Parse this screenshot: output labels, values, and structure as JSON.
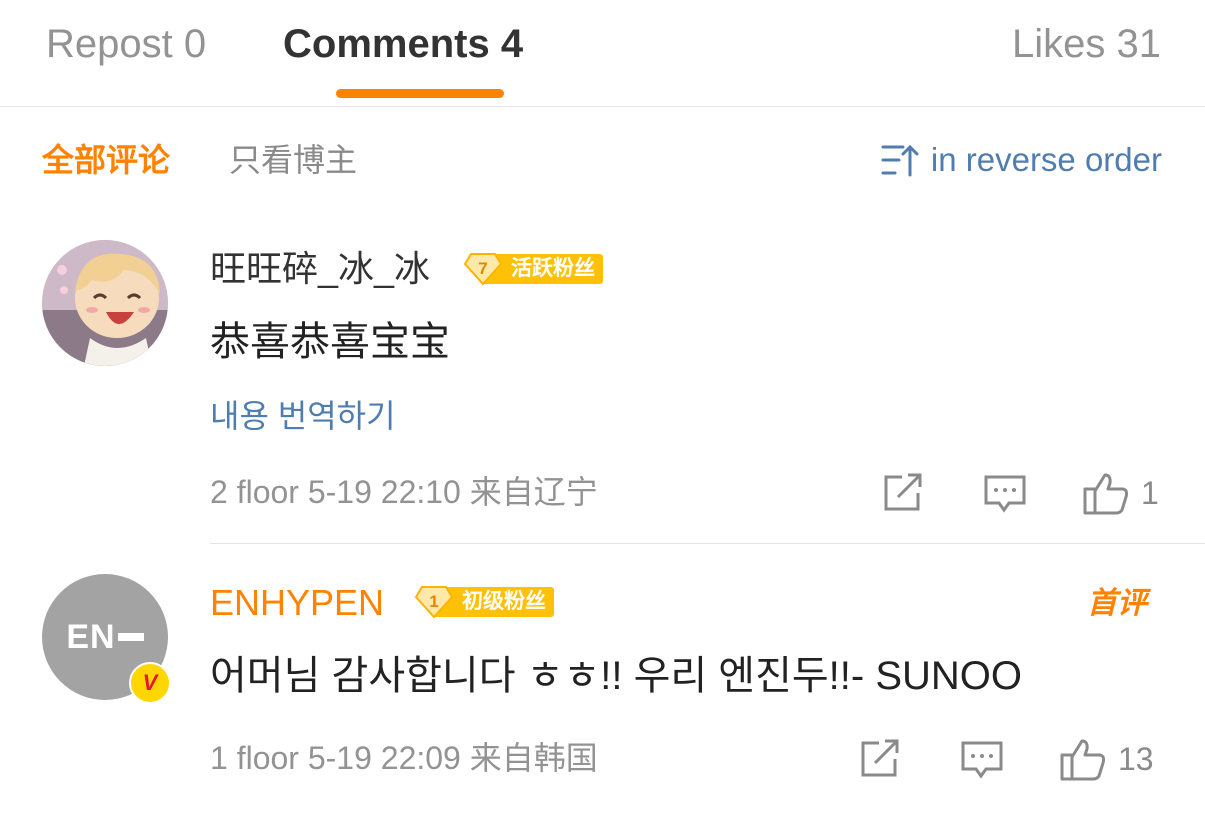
{
  "tabs": {
    "repost": {
      "label": "Repost",
      "count": "0"
    },
    "comments": {
      "label": "Comments",
      "count": "4"
    },
    "likes": {
      "label": "Likes",
      "count": "31"
    }
  },
  "filters": {
    "all": "全部评论",
    "blogger_only": "只看博主",
    "sort": "in reverse order"
  },
  "colors": {
    "accent": "#ff8200",
    "link": "#507daf",
    "badge": "#ffc107",
    "muted": "#939393",
    "verified": "#ffd600",
    "verified_v": "#e6162d"
  },
  "comments": [
    {
      "username": "旺旺碎_冰_冰",
      "username_color": "#333333",
      "badge_level": "7",
      "badge_label": "活跃粉丝",
      "text": "恭喜恭喜宝宝",
      "translate": "내용 번역하기",
      "floor": "2 floor",
      "time": "5-19 22:10",
      "location": "来自辽宁",
      "likes": "1",
      "avatar_icon": "anime-avatar"
    },
    {
      "username": "ENHYPEN",
      "username_color": "#ff8200",
      "badge_level": "1",
      "badge_label": "初级粉丝",
      "first_tag": "首评",
      "avatar_text": "EN",
      "verified_mark": "V",
      "text": "어머님 감사합니다 ㅎㅎ!! 우리 엔진두!!- SUNOO",
      "floor": "1 floor",
      "time": "5-19 22:09",
      "location": "来自韩国",
      "likes": "13"
    }
  ]
}
